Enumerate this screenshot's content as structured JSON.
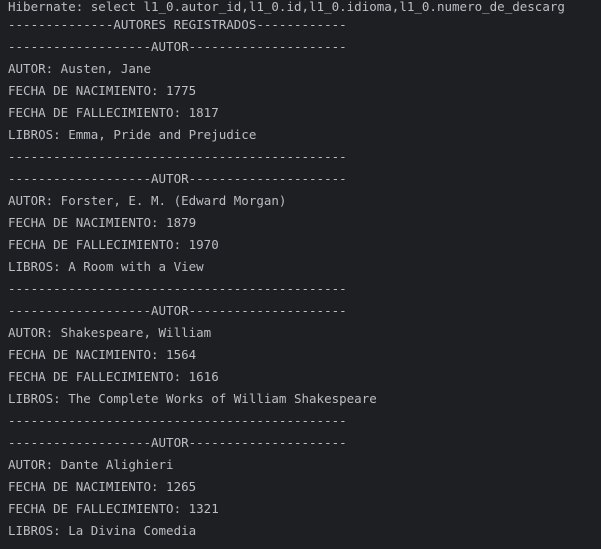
{
  "console": {
    "lines": [
      "Hibernate: select l1_0.autor_id,l1_0.id,l1_0.idioma,l1_0.numero_de_descarg",
      "--------------AUTORES REGISTRADOS------------",
      "-------------------AUTOR---------------------",
      "AUTOR: Austen, Jane",
      "FECHA DE NACIMIENTO: 1775",
      "FECHA DE FALLECIMIENTO: 1817",
      "LIBROS: Emma, Pride and Prejudice",
      "---------------------------------------------",
      "-------------------AUTOR---------------------",
      "AUTOR: Forster, E. M. (Edward Morgan)",
      "FECHA DE NACIMIENTO: 1879",
      "FECHA DE FALLECIMIENTO: 1970",
      "LIBROS: A Room with a View",
      "---------------------------------------------",
      "-------------------AUTOR---------------------",
      "AUTOR: Shakespeare, William",
      "FECHA DE NACIMIENTO: 1564",
      "FECHA DE FALLECIMIENTO: 1616",
      "LIBROS: The Complete Works of William Shakespeare",
      "---------------------------------------------",
      "-------------------AUTOR---------------------",
      "AUTOR: Dante Alighieri",
      "FECHA DE NACIMIENTO: 1265",
      "FECHA DE FALLECIMIENTO: 1321",
      "LIBROS: La Divina Comedia"
    ]
  }
}
